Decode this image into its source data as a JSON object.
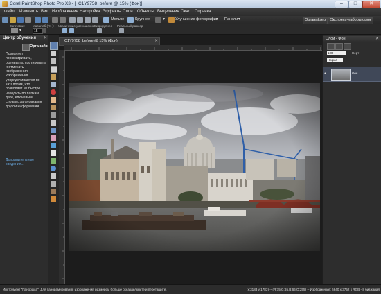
{
  "window": {
    "title": "Corel PaintShop Photo Pro X3 - [_C1Y9758_before @ 15% (Фон)]",
    "min_glyph": "–",
    "max_glyph": "□",
    "close_glyph": "✕"
  },
  "menu": [
    "Файл",
    "Изменить",
    "Вид",
    "Изображение",
    "Настройка",
    "Эффекты",
    "Слои",
    "Объекты",
    "Выделения",
    "Окно",
    "Справка"
  ],
  "toolbar": {
    "small_label": "Мельче",
    "large_label": "Крупнее",
    "enhance_label": "Улучшение фотографии",
    "panels_label": "Панели",
    "organizer_tab": "Органайзер",
    "express_lab_tab": "Экспресс-лаборатория"
  },
  "options_bar": {
    "presets_label": "Заготовки:",
    "zoom_label": "Масштаб ( % ):",
    "zoom_value": "15",
    "zoom_in_out_label": "Увеличение/уменьшение",
    "view_label": "Вид крупнее",
    "actual_size_label": "Реальный размер"
  },
  "learning_center": {
    "title": "Центр обучения",
    "close_glyph": "✕",
    "section": "Органайзер",
    "body": "Позволяет просматривать, оценивать, сортировать и отмечать изображения. Изображения упорядочиваются по каталогам, что позволяет их быстро находить по папкам, дате, ключевым словам, заголовкам и другой информации.",
    "link": "Дополнительные сведения..."
  },
  "document": {
    "tab_title": "_C1Y9758_before @ 15% (Фон)",
    "close_glyph": "✕"
  },
  "layers": {
    "title": "Слой - Фон",
    "close_glyph": "✕",
    "opacity": "100",
    "opacity_label": "Нерт",
    "blend": "Норма",
    "eye_glyph": "●",
    "layer_name": "Фон"
  },
  "status": {
    "hint": "Инструмент \"Панорама\": Для панорамирования изображений размером больше окна щелкните и перетащите.",
    "info": "(x:3183 y:1783) -- (R:75,G:65,B:66,O:255) -- Изображение: 5640 x 3752 x RGB - 8 бит/канал"
  },
  "icons": {
    "app": "paintshop-app-icon",
    "organizer": "organizer-icon",
    "tools": [
      "pan-tool-icon",
      "pick-tool-icon",
      "move-tool-icon",
      "selection-tool-icon",
      "crop-tool-icon",
      "straighten-tool-icon",
      "red-eye-tool-icon",
      "makeover-tool-icon",
      "clone-brush-icon",
      "scratch-remover-icon",
      "object-remover-icon",
      "paint-brush-icon",
      "eraser-icon",
      "fill-icon",
      "text-tool-icon",
      "pen-tool-icon",
      "preset-shape-icon",
      "dropper-icon",
      "lighten-darken-icon",
      "smudge-icon",
      "color-replacer-icon"
    ]
  }
}
